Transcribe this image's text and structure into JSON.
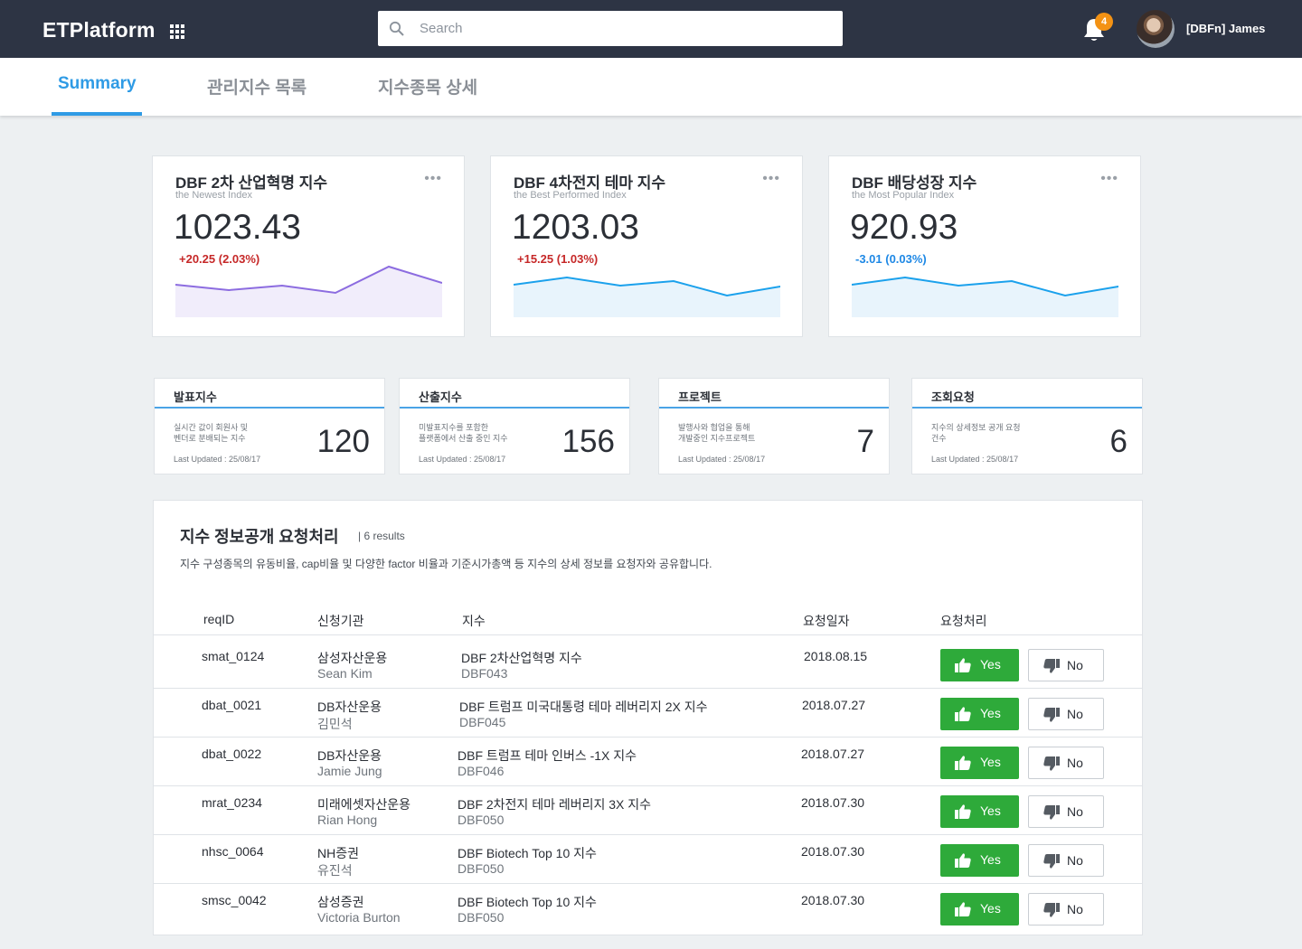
{
  "header": {
    "brand": "ETPlatform",
    "search_placeholder": "Search",
    "notification_count": "4",
    "username": "[DBFn] James"
  },
  "tabs": [
    {
      "label": "Summary",
      "active": true
    },
    {
      "label": "관리지수 목록",
      "active": false
    },
    {
      "label": "지수종목 상세",
      "active": false
    }
  ],
  "index_cards": [
    {
      "title": "DBF 2차 산업혁명 지수",
      "subtitle": "the Newest Index",
      "value": "1023.43",
      "change": "+20.25 (2.03%)",
      "direction": "up",
      "color": "#8c6ce0",
      "fill": "#f1edfb",
      "spark": [
        20,
        26,
        21,
        29,
        0,
        18
      ]
    },
    {
      "title": "DBF 4차전지 테마 지수",
      "subtitle": "the Best Performed Index",
      "value": "1203.03",
      "change": "+15.25 (1.03%)",
      "direction": "up",
      "color": "#1ba1ec",
      "fill": "#e8f4fc",
      "spark": [
        20,
        12,
        21,
        16,
        32,
        22
      ]
    },
    {
      "title": "DBF 배당성장 지수",
      "subtitle": "the Most Popular Index",
      "value": "920.93",
      "change": "-3.01 (0.03%)",
      "direction": "down",
      "color": "#1ba1ec",
      "fill": "#e8f4fc",
      "spark": [
        20,
        12,
        21,
        16,
        32,
        22
      ]
    }
  ],
  "stat_cards": [
    {
      "title": "발표지수",
      "desc1": "실시간 값이 회원사 및",
      "desc2": "벤더로 분배되는 지수",
      "updated": "Last Updated : 25/08/17",
      "value": "120"
    },
    {
      "title": "산출지수",
      "desc1": "미발표지수를 포함한",
      "desc2": "플랫폼에서 산출 중인 지수",
      "updated": "Last Updated : 25/08/17",
      "value": "156"
    },
    {
      "title": "프로젝트",
      "desc1": "발행사와 협업을 통해",
      "desc2": "개발중인 지수프로젝트",
      "updated": "Last Updated : 25/08/17",
      "value": "7"
    },
    {
      "title": "조회요청",
      "desc1": "지수의 상세정보 공개 요청",
      "desc2": "건수",
      "updated": "Last Updated : 25/08/17",
      "value": "6"
    }
  ],
  "requests": {
    "title": "지수 정보공개 요청처리",
    "count": "| 6 results",
    "description": "지수 구성종목의 유동비율, cap비율 및 다양한 factor 비율과 기준시가총액 등 지수의 상세 정보를 요청자와 공유합니다.",
    "columns": [
      "reqID",
      "신청기관",
      "지수",
      "요청일자",
      "요청처리"
    ],
    "yes_label": "Yes",
    "no_label": "No",
    "rows": [
      {
        "id": "smat_0124",
        "org": "삼성자산운용",
        "person": "Sean Kim",
        "index": "DBF 2차산업혁명 지수",
        "code": "DBF043",
        "date": "2018.08.15"
      },
      {
        "id": "dbat_0021",
        "org": "DB자산운용",
        "person": "김민석",
        "index": "DBF 트럼프 미국대통령 테마 레버리지 2X 지수",
        "code": "DBF045",
        "date": "2018.07.27"
      },
      {
        "id": "dbat_0022",
        "org": "DB자산운용",
        "person": "Jamie Jung",
        "index": "DBF 트럼프 테마 인버스 -1X 지수",
        "code": "DBF046",
        "date": "2018.07.27"
      },
      {
        "id": "mrat_0234",
        "org": "미래에셋자산운용",
        "person": "Rian Hong",
        "index": "DBF 2차전지 테마 레버리지 3X 지수",
        "code": "DBF050",
        "date": "2018.07.30"
      },
      {
        "id": "nhsc_0064",
        "org": "NH증권",
        "person": "유진석",
        "index": "DBF Biotech Top 10 지수",
        "code": "DBF050",
        "date": "2018.07.30"
      },
      {
        "id": "smsc_0042",
        "org": "삼성증권",
        "person": "Victoria Burton",
        "index": "DBF Biotech Top 10 지수",
        "code": "DBF050",
        "date": "2018.07.30"
      }
    ]
  }
}
